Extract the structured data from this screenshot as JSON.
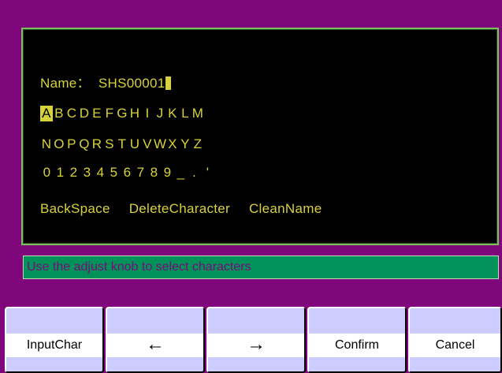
{
  "editor": {
    "name_label": "Name：",
    "name_value": "SHS00001",
    "selected_index": 0,
    "row_letters_1": [
      "A",
      "B",
      "C",
      "D",
      "E",
      "F",
      "G",
      "H",
      "I",
      "J",
      "K",
      "L",
      "M"
    ],
    "row_letters_2": [
      "N",
      "O",
      "P",
      "Q",
      "R",
      "S",
      "T",
      "U",
      "V",
      "W",
      "X",
      "Y",
      "Z"
    ],
    "row_symbols": [
      "0",
      "1",
      "2",
      "3",
      "4",
      "5",
      "6",
      "7",
      "8",
      "9",
      "_",
      ".",
      " '"
    ],
    "actions": [
      "BackSpace",
      "DeleteCharacter",
      "CleanName"
    ]
  },
  "status": {
    "message": "Use the adjust knob to select characters"
  },
  "softkeys": {
    "key1": "InputChar",
    "key2": "←",
    "key3": "→",
    "key4": "Confirm",
    "key5": "Cancel"
  },
  "colors": {
    "background": "#80067c",
    "screen": "#000000",
    "text": "#d8d23a",
    "status_bar": "#009259",
    "status_text": "#7d0a7a",
    "softkey_bg": "#ccccff"
  }
}
